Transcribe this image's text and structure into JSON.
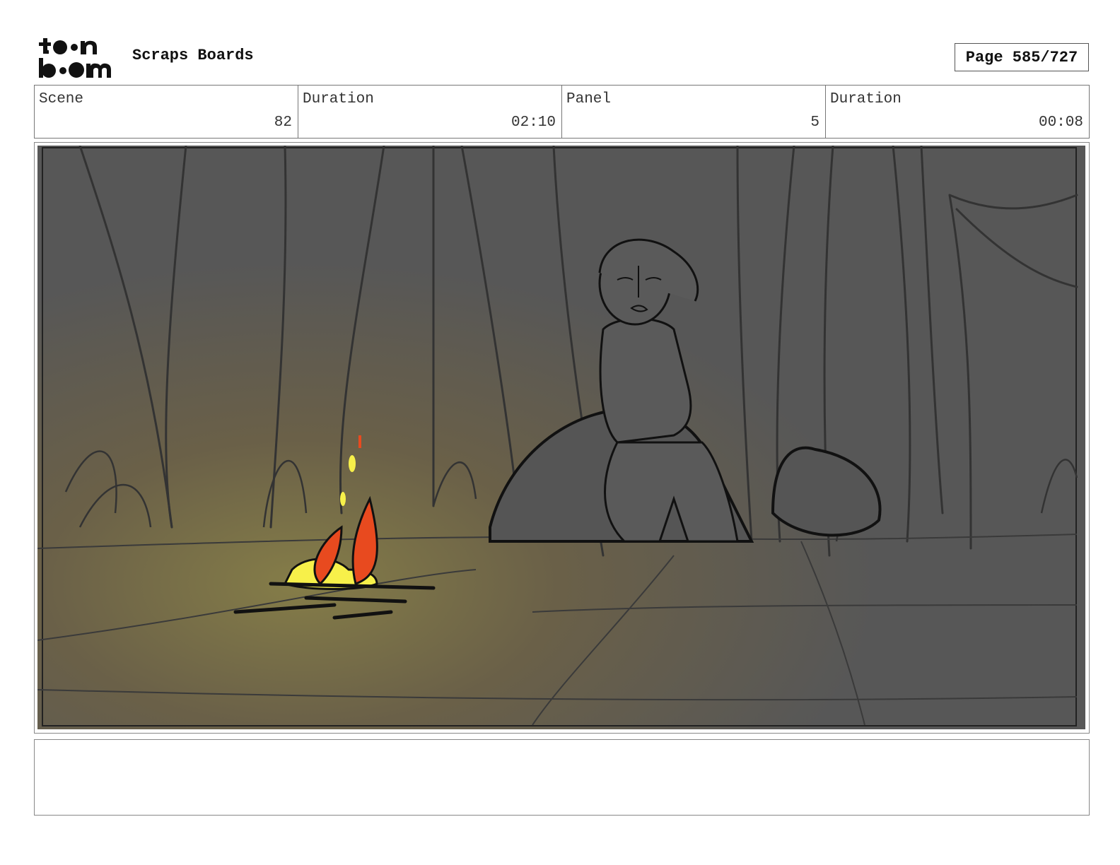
{
  "header": {
    "logo_text": "toon boom",
    "title": "Scraps Boards",
    "page_label": "Page 585/727"
  },
  "info": {
    "scene_label": "Scene",
    "scene_value": "82",
    "scene_duration_label": "Duration",
    "scene_duration_value": "02:10",
    "panel_label": "Panel",
    "panel_value": "5",
    "panel_duration_label": "Duration",
    "panel_duration_value": "00:08"
  },
  "panel": {
    "image": "storyboard-sketch: character kneeling by a campfire in a dark forest"
  },
  "notes": {
    "text": ""
  }
}
